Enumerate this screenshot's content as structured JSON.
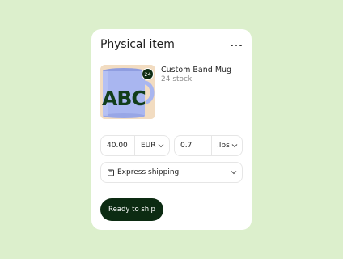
{
  "card": {
    "title": "Physical item",
    "more_icon": "more-horizontal-icon"
  },
  "product": {
    "name": "Custom Band Mug",
    "stock": "24 stock",
    "badge": "24",
    "image_text": "ABC",
    "mug_color": "#a9b6f0",
    "letter_color": "#123d1a",
    "image_bg": "#f2dcc1"
  },
  "price": {
    "value": "40.00",
    "currency": "EUR"
  },
  "weight": {
    "value": "0.7",
    "unit": ".lbs"
  },
  "shipping": {
    "icon": "package-icon",
    "label": "Express shipping"
  },
  "action": {
    "label": "Ready to ship",
    "color": "#0c2b12"
  }
}
